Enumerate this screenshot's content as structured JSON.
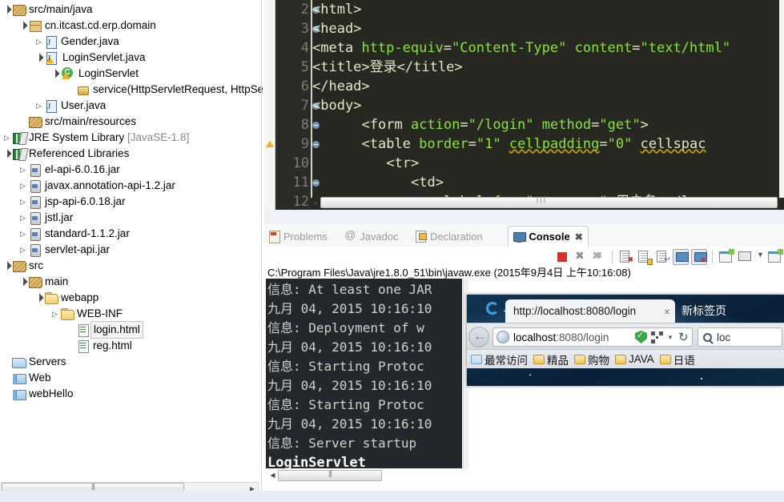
{
  "explorer": {
    "name": "package-explorer",
    "tree": [
      {
        "label": "src/main/java",
        "indent": 0,
        "arrow": "open",
        "icon": "source-folder-icon"
      },
      {
        "label": "cn.itcast.cd.erp.domain",
        "indent": 1,
        "arrow": "open",
        "icon": "package-icon"
      },
      {
        "label": "Gender.java",
        "indent": 2,
        "arrow": "closed",
        "icon": "java-interface-icon"
      },
      {
        "label": "LoginServlet.java",
        "indent": 2,
        "arrow": "open",
        "icon": "java-class-warning-icon"
      },
      {
        "label": "LoginServlet",
        "indent": 3,
        "arrow": "open",
        "icon": "class-icon"
      },
      {
        "label": "service(HttpServletRequest, HttpServ",
        "indent": 4,
        "arrow": "blank",
        "icon": "method-icon"
      },
      {
        "label": "User.java",
        "indent": 2,
        "arrow": "closed",
        "icon": "java-class-icon"
      },
      {
        "label": "src/main/resources",
        "indent": 1,
        "arrow": "blank",
        "icon": "source-folder-icon"
      },
      {
        "label": "JRE System Library",
        "suffix": "[JavaSE-1.8]",
        "indent": 0,
        "arrow": "closed",
        "icon": "library-icon"
      },
      {
        "label": "Referenced Libraries",
        "indent": 0,
        "arrow": "open",
        "icon": "library-icon"
      },
      {
        "label": "el-api-6.0.16.jar",
        "indent": 1,
        "arrow": "closed",
        "icon": "jar-icon"
      },
      {
        "label": "javax.annotation-api-1.2.jar",
        "indent": 1,
        "arrow": "closed",
        "icon": "jar-icon"
      },
      {
        "label": "jsp-api-6.0.18.jar",
        "indent": 1,
        "arrow": "closed",
        "icon": "jar-icon"
      },
      {
        "label": "jstl.jar",
        "indent": 1,
        "arrow": "closed",
        "icon": "jar-icon"
      },
      {
        "label": "standard-1.1.2.jar",
        "indent": 1,
        "arrow": "closed",
        "icon": "jar-icon"
      },
      {
        "label": "servlet-api.jar",
        "indent": 1,
        "arrow": "closed",
        "icon": "jar-icon"
      },
      {
        "label": "src",
        "indent": 0,
        "arrow": "open",
        "icon": "source-folder-icon"
      },
      {
        "label": "main",
        "indent": 1,
        "arrow": "open",
        "icon": "source-folder-icon"
      },
      {
        "label": "webapp",
        "indent": 2,
        "arrow": "open",
        "icon": "folder-icon"
      },
      {
        "label": "WEB-INF",
        "indent": 3,
        "arrow": "closed",
        "icon": "folder-icon"
      },
      {
        "label": "login.html",
        "indent": 4,
        "arrow": "blank",
        "icon": "html-file-icon",
        "selected": true
      },
      {
        "label": "reg.html",
        "indent": 4,
        "arrow": "blank",
        "icon": "html-file-icon"
      },
      {
        "label": "Servers",
        "indent": -1,
        "arrow": "blank",
        "icon": "servers-icon"
      },
      {
        "label": "Web",
        "indent": -1,
        "arrow": "blank",
        "icon": "project-icon"
      },
      {
        "label": "webHello",
        "indent": -1,
        "arrow": "blank",
        "icon": "project-icon"
      }
    ],
    "scrollbar": {
      "name": "horizontal-scrollbar"
    }
  },
  "editor": {
    "name": "html-code-editor",
    "lines": [
      {
        "num": "2",
        "fold": true,
        "warn": false,
        "code": "<html>"
      },
      {
        "num": "3",
        "fold": true,
        "warn": false,
        "code": "<head>"
      },
      {
        "num": "4",
        "fold": false,
        "warn": false,
        "code": "<meta http-equiv=\"Content-Type\" content=\"text/html"
      },
      {
        "num": "5",
        "fold": false,
        "warn": false,
        "code": "<title>登录</title>"
      },
      {
        "num": "6",
        "fold": false,
        "warn": false,
        "code": "</head>"
      },
      {
        "num": "7",
        "fold": true,
        "warn": false,
        "code": "<body>"
      },
      {
        "num": "8",
        "fold": true,
        "warn": false,
        "code": "      <form action=\"/login\" method=\"get\">"
      },
      {
        "num": "9",
        "fold": true,
        "warn": true,
        "code": "      <table border=\"1\" cellpadding=\"0\" cellspac"
      },
      {
        "num": "10",
        "fold": false,
        "warn": false,
        "code": "         <tr>"
      },
      {
        "num": "11",
        "fold": true,
        "warn": false,
        "code": "            <td>"
      },
      {
        "num": "12",
        "fold": false,
        "warn": false,
        "code": "               <label for=\"username\">用户名:</l"
      }
    ],
    "scrollbar": {
      "name": "editor-horizontal-scrollbar"
    }
  },
  "console": {
    "name": "console-view",
    "tabs": [
      {
        "label": "Problems",
        "icon": "problems-icon",
        "active": false
      },
      {
        "label": "Javadoc",
        "icon": "javadoc-icon",
        "active": false
      },
      {
        "label": "Declaration",
        "icon": "declaration-icon",
        "active": false
      },
      {
        "label": "Console",
        "icon": "console-icon",
        "active": true
      }
    ],
    "tab_close_glyph": "✖",
    "toolbar": [
      {
        "name": "terminate-button",
        "icon": "stop-icon"
      },
      {
        "name": "remove-launch-button",
        "icon": "close-x-icon"
      },
      {
        "name": "remove-all-launches-button",
        "icon": "close-all-x-icon"
      },
      {
        "name": "toolbar-separator-1",
        "icon": "separator"
      },
      {
        "name": "clear-console-button",
        "icon": "clear-console-icon"
      },
      {
        "name": "scroll-lock-button",
        "icon": "scroll-lock-icon"
      },
      {
        "name": "word-wrap-button",
        "icon": "word-wrap-icon"
      },
      {
        "name": "show-console-on-output-button",
        "icon": "show-console-icon"
      },
      {
        "name": "show-console-on-error-button",
        "icon": "show-console-error-icon"
      },
      {
        "name": "toolbar-separator-2",
        "icon": "separator"
      },
      {
        "name": "pin-console-button",
        "icon": "pin-console-icon"
      },
      {
        "name": "display-selected-console-button",
        "icon": "display-console-icon"
      },
      {
        "name": "console-menu-dropdown",
        "icon": "chevron-down-icon"
      },
      {
        "name": "open-console-button",
        "icon": "new-console-icon"
      }
    ],
    "process_label": "C:\\Program Files\\Java\\jre1.8.0_51\\bin\\javaw.exe (2015年9月4日 上午10:16:08)",
    "output": [
      {
        "text": "信息: At least one JAR",
        "highlight": false
      },
      {
        "text": "九月 04, 2015 10:16:10",
        "highlight": false
      },
      {
        "text": "信息: Deployment of w",
        "highlight": false
      },
      {
        "text": "九月 04, 2015 10:16:10",
        "highlight": false
      },
      {
        "text": "信息: Starting Protoc",
        "highlight": false
      },
      {
        "text": "九月 04, 2015 10:16:10",
        "highlight": false
      },
      {
        "text": "信息: Starting Protoc",
        "highlight": false
      },
      {
        "text": "九月 04, 2015 10:16:10",
        "highlight": false
      },
      {
        "text": "信息: Server startup",
        "highlight": false
      },
      {
        "text": "LoginServlet",
        "highlight": true
      }
    ],
    "scrollbar": {
      "name": "console-horizontal-scrollbar"
    }
  },
  "browser": {
    "name": "firefox-window",
    "tabs": [
      {
        "label": "http://localhost:8080/login",
        "active": true,
        "close": "×"
      },
      {
        "label": "新标签页",
        "active": false
      }
    ],
    "back_button": "back-button",
    "url": {
      "host": "localhost",
      "rest": ":8080/login"
    },
    "search_placeholder": "loc",
    "bookmarks": [
      {
        "label": "最常访问",
        "icon": "most-visited-icon"
      },
      {
        "label": "精品",
        "icon": "folder-icon"
      },
      {
        "label": "购物",
        "icon": "folder-icon"
      },
      {
        "label": "JAVA",
        "icon": "folder-icon"
      },
      {
        "label": "日语",
        "icon": "folder-icon"
      }
    ]
  }
}
